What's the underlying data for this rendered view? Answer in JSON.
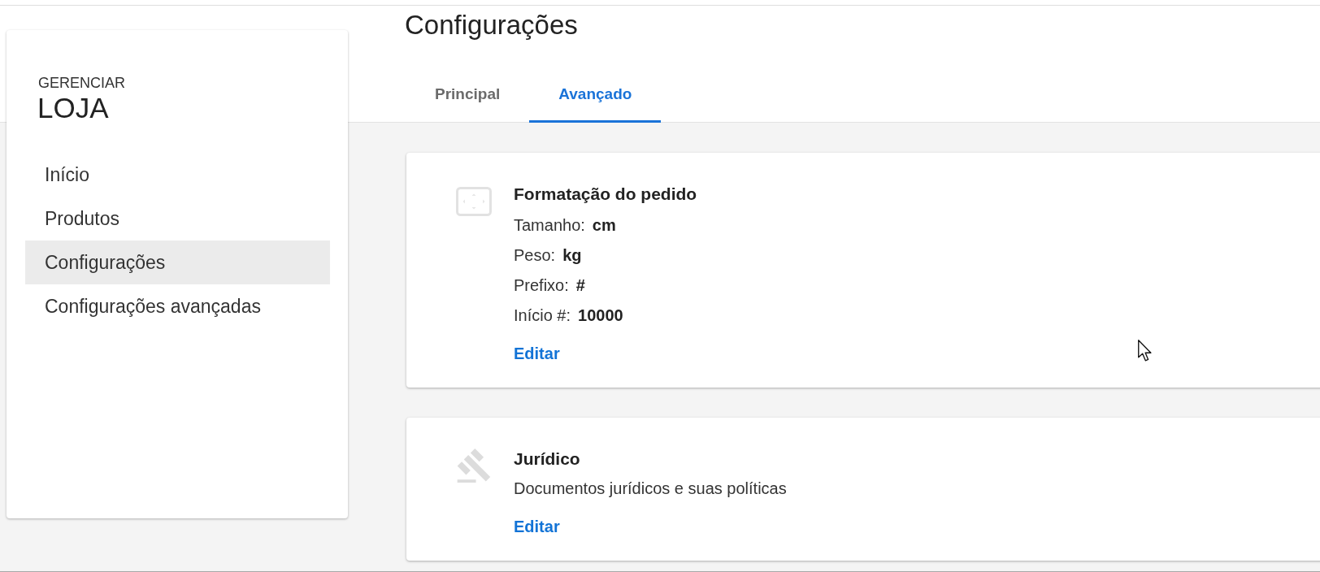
{
  "sidebar": {
    "kicker": "GERENCIAR",
    "title": "LOJA",
    "items": [
      {
        "label": "Início",
        "selected": false
      },
      {
        "label": "Produtos",
        "selected": false
      },
      {
        "label": "Configurações",
        "selected": true
      },
      {
        "label": "Configurações avançadas",
        "selected": false
      }
    ]
  },
  "page": {
    "title": "Configurações",
    "tabs": [
      {
        "label": "Principal",
        "selected": false
      },
      {
        "label": "Avançado",
        "selected": true
      }
    ]
  },
  "cards": [
    {
      "kind": "format",
      "title": "Formatação do pedido",
      "fields": [
        {
          "label": "Tamanho:",
          "value": "cm"
        },
        {
          "label": "Peso:",
          "value": "kg"
        },
        {
          "label": "Prefixo:",
          "value": "#"
        },
        {
          "label": "Início #:",
          "value": "10000"
        }
      ],
      "action": "Editar"
    },
    {
      "kind": "legal",
      "title": "Jurídico",
      "description": "Documentos jurídicos e suas políticas",
      "action": "Editar"
    }
  ]
}
